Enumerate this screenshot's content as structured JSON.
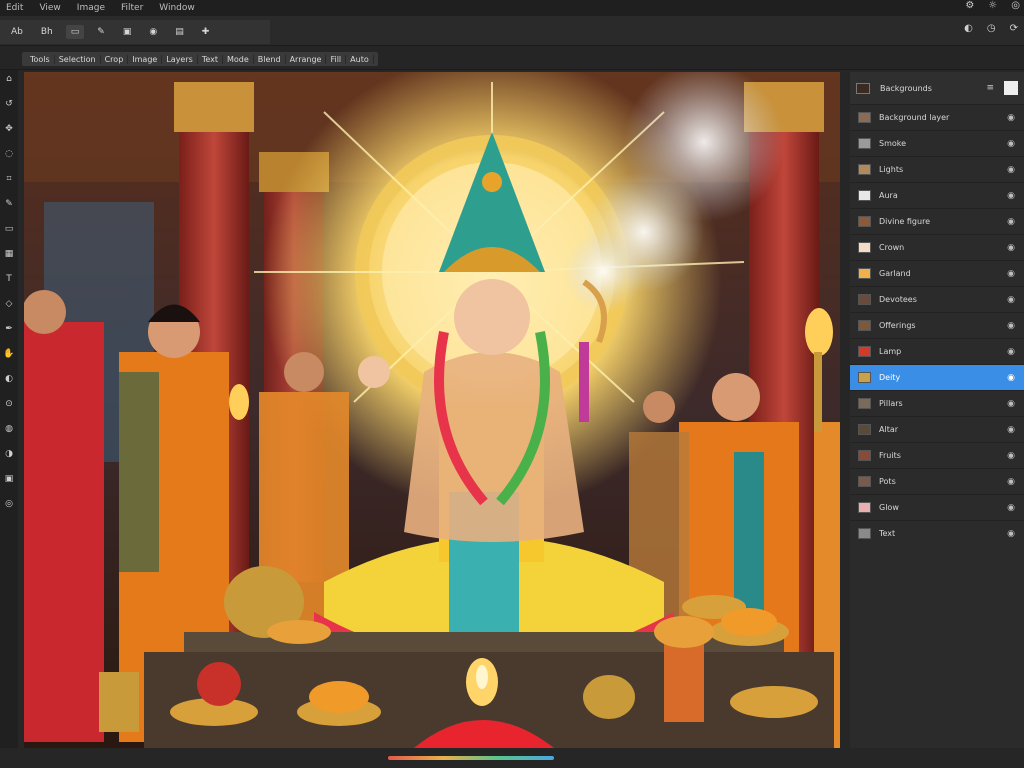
{
  "menu": [
    "Edit",
    "View",
    "Image",
    "Filter",
    "Window"
  ],
  "topbar_right_icons": [
    "gear-icon",
    "settings-icon",
    "user-icon"
  ],
  "toolbar": {
    "items": [
      {
        "label": "Ab",
        "icon": "text-icon"
      },
      {
        "label": "Bh",
        "icon": "brush-icon"
      },
      {
        "label": "▭",
        "icon": "frame-icon"
      },
      {
        "label": "✎",
        "icon": "pen-icon"
      },
      {
        "label": "▣",
        "icon": "select-icon"
      },
      {
        "label": "◉",
        "icon": "eye-icon"
      },
      {
        "label": "▤",
        "icon": "layers-icon"
      },
      {
        "label": "✚",
        "icon": "add-icon"
      }
    ],
    "right_icons": [
      "zoom-icon",
      "clock-icon",
      "sync-icon"
    ]
  },
  "options": [
    "Tools",
    "Selection",
    "Crop",
    "Image",
    "Layers",
    "Text",
    "Mode",
    "Blend",
    "Arrange",
    "Fill",
    "Auto"
  ],
  "left_tools": [
    "home-icon",
    "history-icon",
    "move-icon",
    "lasso-icon",
    "crop-icon",
    "brush-icon",
    "eraser-icon",
    "gradient-icon",
    "text-icon",
    "shape-icon",
    "pen-icon",
    "hand-icon",
    "zoom-icon",
    "picker-icon",
    "blur-icon",
    "dodge-icon",
    "stamp-icon",
    "sponge-icon"
  ],
  "panel": {
    "title": "Backgrounds",
    "swatch_color": "#3a2a22",
    "layers": [
      {
        "label": "Background layer",
        "thumb": "#8a6b55",
        "selected": false
      },
      {
        "label": "Smoke",
        "thumb": "#9a9a9a",
        "selected": false
      },
      {
        "label": "Lights",
        "thumb": "#b08a5a",
        "selected": false
      },
      {
        "label": "Aura",
        "thumb": "#e8e8e8",
        "selected": false
      },
      {
        "label": "Divine figure",
        "thumb": "#8a5a3a",
        "selected": false
      },
      {
        "label": "Crown",
        "thumb": "#f3dcc8",
        "selected": false
      },
      {
        "label": "Garland",
        "thumb": "#f0b04a",
        "selected": false
      },
      {
        "label": "Devotees",
        "thumb": "#6a4a3a",
        "selected": false
      },
      {
        "label": "Offerings",
        "thumb": "#7a5a3a",
        "selected": false
      },
      {
        "label": "Lamp",
        "thumb": "#d23a2a",
        "selected": false
      },
      {
        "label": "Deity",
        "thumb": "#c8a24a",
        "selected": true
      },
      {
        "label": "Pillars",
        "thumb": "#7a6a5a",
        "selected": false
      },
      {
        "label": "Altar",
        "thumb": "#5a4a3a",
        "selected": false
      },
      {
        "label": "Fruits",
        "thumb": "#8a4a3a",
        "selected": false
      },
      {
        "label": "Pots",
        "thumb": "#7a5a4a",
        "selected": false
      },
      {
        "label": "Glow",
        "thumb": "#e8b0b0",
        "selected": false
      },
      {
        "label": "Text",
        "thumb": "#8a8a8a",
        "selected": false
      }
    ]
  },
  "progress": 1.0,
  "colors": {
    "selection": "#3a8ee6",
    "ui_dark": "#262626"
  }
}
